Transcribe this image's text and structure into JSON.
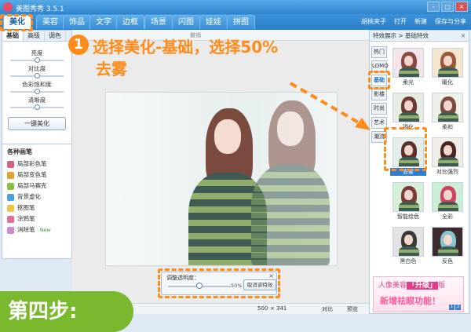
{
  "window": {
    "title": "美图秀秀 3.5.1",
    "controls": [
      "-",
      "□",
      "×"
    ]
  },
  "menu": {
    "tabs": [
      "美化",
      "美容",
      "饰品",
      "文字",
      "边框",
      "场景",
      "闪图",
      "娃娃",
      "拼图"
    ],
    "active_tab": "美化",
    "user": "胡桃夹子",
    "open_label": "打开",
    "new_label": "新建",
    "save_label": "保存与分享"
  },
  "left_panel": {
    "subtabs": [
      "基础",
      "高级",
      "调色"
    ],
    "sliders": [
      {
        "label": "亮度",
        "value": 0.5
      },
      {
        "label": "对比度",
        "value": 0.5
      },
      {
        "label": "色彩饱和度",
        "value": 0.5
      },
      {
        "label": "清晰度",
        "value": 0.5
      }
    ],
    "one_click_label": "一键美化",
    "pens_title": "各种画笔",
    "pens": [
      {
        "label": "局部彩色笔",
        "color": "#d95f7e"
      },
      {
        "label": "局部变色笔",
        "color": "#e6a230"
      },
      {
        "label": "局部马赛克",
        "color": "#8cbf3f"
      },
      {
        "label": "背景虚化",
        "color": "#4aa3e0"
      },
      {
        "label": "抠图笔",
        "color": "#f0c24a"
      },
      {
        "label": "涂鸦笔",
        "color": "#e36b9a"
      },
      {
        "label": "消除笔",
        "color": "#d08ad4",
        "badge": "New"
      }
    ]
  },
  "canvas": {
    "toolbar_hint": "撤销",
    "transparency_panel": {
      "label": "调整透明度：",
      "value_text": "50%",
      "value": 0.5,
      "cancel_label": "取消该特效"
    },
    "status": {
      "width": "500",
      "sep": "×",
      "height": "341",
      "compare_label": "对比",
      "preview_label": "预览"
    }
  },
  "right_panel": {
    "header": "特效展示 > 基础特效",
    "categories": [
      "热门",
      "LOMO",
      "基础",
      "影楼",
      "时尚",
      "艺术",
      "潮流"
    ],
    "active_category": "基础",
    "thumbnails": [
      {
        "label": "柔光",
        "bg": "#f2e4e8",
        "hair": "#8a4a43"
      },
      {
        "label": "暖化",
        "bg": "#f4e6cf",
        "hair": "#9a5a3a"
      },
      {
        "label": "锐化",
        "bg": "#e6ece4",
        "hair": "#6b3a33"
      },
      {
        "label": "柔和",
        "bg": "#eef0ea",
        "hair": "#7a4a3f"
      },
      {
        "label": "去雾",
        "bg": "#e4ecec",
        "hair": "#5a3029",
        "selected": true
      },
      {
        "label": "对比强烈",
        "bg": "#f0eee6",
        "hair": "#4a2622"
      },
      {
        "label": "智能绘色",
        "bg": "#d6efd6",
        "hair": "#7a3c36"
      },
      {
        "label": "全彩",
        "bg": "#cbeed8",
        "hair": "#d04060"
      },
      {
        "label": "黑白色",
        "bg": "#e2e2e2",
        "hair": "#3a3a3a"
      },
      {
        "label": "反色",
        "bg": "#3d2b2f",
        "hair": "#84c6d0"
      }
    ]
  },
  "ad": {
    "line1_a": "人像美容",
    "line1_b": "「升级」",
    "line1_c": "版",
    "line2": "新增祛眼功能！",
    "page_current": "1",
    "page_total": "2"
  },
  "annotation": {
    "number": "1",
    "line1": "选择美化-基础，选择50%",
    "line2": "去雾",
    "color": "#ff8c1a",
    "step_banner": "第四步:",
    "banner_color": "#7ab82e"
  }
}
